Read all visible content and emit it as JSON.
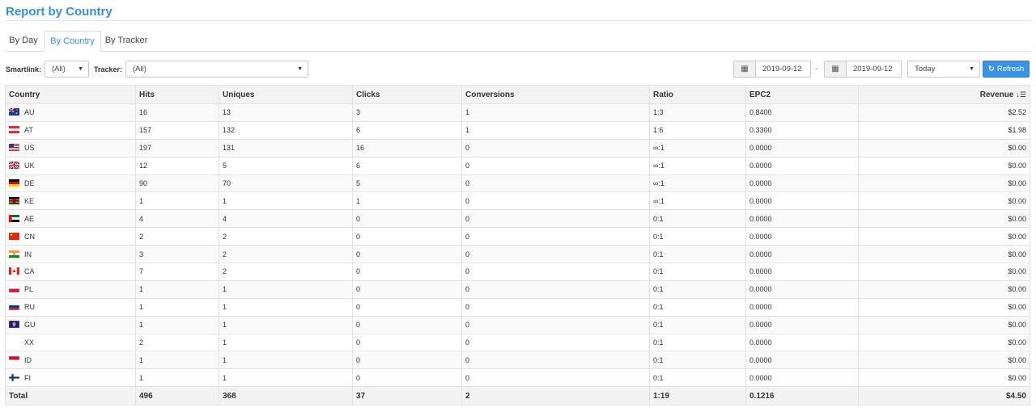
{
  "page": {
    "title": "Report by Country"
  },
  "tabs": [
    {
      "label": "By Day",
      "active": false
    },
    {
      "label": "By Country",
      "active": true
    },
    {
      "label": "By Tracker",
      "active": false
    }
  ],
  "filters": {
    "smartlink_label": "Smartlink:",
    "smartlink_value": "(All)",
    "tracker_label": "Tracker:",
    "tracker_value": "(All)",
    "date_from": "2019-09-12",
    "date_separator": "-",
    "date_to": "2019-09-12",
    "period_value": "Today",
    "refresh_label": "Refresh"
  },
  "table": {
    "columns": [
      "Country",
      "Hits",
      "Uniques",
      "Clicks",
      "Conversions",
      "Ratio",
      "EPC2",
      "Revenue"
    ],
    "rows": [
      {
        "country": "AU",
        "flag": "au-flag-icon",
        "hits": "16",
        "uniques": "13",
        "clicks": "3",
        "conversions": "1",
        "ratio": "1:3",
        "epc2": "0.8400",
        "revenue": "$2.52"
      },
      {
        "country": "AT",
        "flag": "at-flag-icon",
        "hits": "157",
        "uniques": "132",
        "clicks": "6",
        "conversions": "1",
        "ratio": "1:6",
        "epc2": "0.3300",
        "revenue": "$1.98"
      },
      {
        "country": "US",
        "flag": "us-flag-icon",
        "hits": "197",
        "uniques": "131",
        "clicks": "16",
        "conversions": "0",
        "ratio": "∞:1",
        "epc2": "0.0000",
        "revenue": "$0.00"
      },
      {
        "country": "UK",
        "flag": "uk-flag-icon",
        "hits": "12",
        "uniques": "5",
        "clicks": "6",
        "conversions": "0",
        "ratio": "∞:1",
        "epc2": "0.0000",
        "revenue": "$0.00"
      },
      {
        "country": "DE",
        "flag": "de-flag-icon",
        "hits": "90",
        "uniques": "70",
        "clicks": "5",
        "conversions": "0",
        "ratio": "∞:1",
        "epc2": "0.0000",
        "revenue": "$0.00"
      },
      {
        "country": "KE",
        "flag": "ke-flag-icon",
        "hits": "1",
        "uniques": "1",
        "clicks": "1",
        "conversions": "0",
        "ratio": "∞:1",
        "epc2": "0.0000",
        "revenue": "$0.00"
      },
      {
        "country": "AE",
        "flag": "ae-flag-icon",
        "hits": "4",
        "uniques": "4",
        "clicks": "0",
        "conversions": "0",
        "ratio": "0:1",
        "epc2": "0.0000",
        "revenue": "$0.00"
      },
      {
        "country": "CN",
        "flag": "cn-flag-icon",
        "hits": "2",
        "uniques": "2",
        "clicks": "0",
        "conversions": "0",
        "ratio": "0:1",
        "epc2": "0.0000",
        "revenue": "$0.00"
      },
      {
        "country": "IN",
        "flag": "in-flag-icon",
        "hits": "3",
        "uniques": "2",
        "clicks": "0",
        "conversions": "0",
        "ratio": "0:1",
        "epc2": "0.0000",
        "revenue": "$0.00"
      },
      {
        "country": "CA",
        "flag": "ca-flag-icon",
        "hits": "7",
        "uniques": "2",
        "clicks": "0",
        "conversions": "0",
        "ratio": "0:1",
        "epc2": "0.0000",
        "revenue": "$0.00"
      },
      {
        "country": "PL",
        "flag": "pl-flag-icon",
        "hits": "1",
        "uniques": "1",
        "clicks": "0",
        "conversions": "0",
        "ratio": "0:1",
        "epc2": "0.0000",
        "revenue": "$0.00"
      },
      {
        "country": "RU",
        "flag": "ru-flag-icon",
        "hits": "1",
        "uniques": "1",
        "clicks": "0",
        "conversions": "0",
        "ratio": "0:1",
        "epc2": "0.0000",
        "revenue": "$0.00"
      },
      {
        "country": "GU",
        "flag": "gu-flag-icon",
        "hits": "1",
        "uniques": "1",
        "clicks": "0",
        "conversions": "0",
        "ratio": "0:1",
        "epc2": "0.0000",
        "revenue": "$0.00"
      },
      {
        "country": "XX",
        "flag": "none",
        "hits": "2",
        "uniques": "1",
        "clicks": "0",
        "conversions": "0",
        "ratio": "0:1",
        "epc2": "0.0000",
        "revenue": "$0.00"
      },
      {
        "country": "ID",
        "flag": "id-flag-icon",
        "hits": "1",
        "uniques": "1",
        "clicks": "0",
        "conversions": "0",
        "ratio": "0:1",
        "epc2": "0.0000",
        "revenue": "$0.00"
      },
      {
        "country": "FI",
        "flag": "fi-flag-icon",
        "hits": "1",
        "uniques": "1",
        "clicks": "0",
        "conversions": "0",
        "ratio": "0:1",
        "epc2": "0.0000",
        "revenue": "$0.00"
      }
    ],
    "totals": {
      "label": "Total",
      "hits": "496",
      "uniques": "368",
      "clicks": "37",
      "conversions": "2",
      "ratio": "1:19",
      "epc2": "0.1216",
      "revenue": "$4.50"
    }
  },
  "colors": {
    "accent": "#3a8fd9",
    "button": "#3b93e6"
  }
}
